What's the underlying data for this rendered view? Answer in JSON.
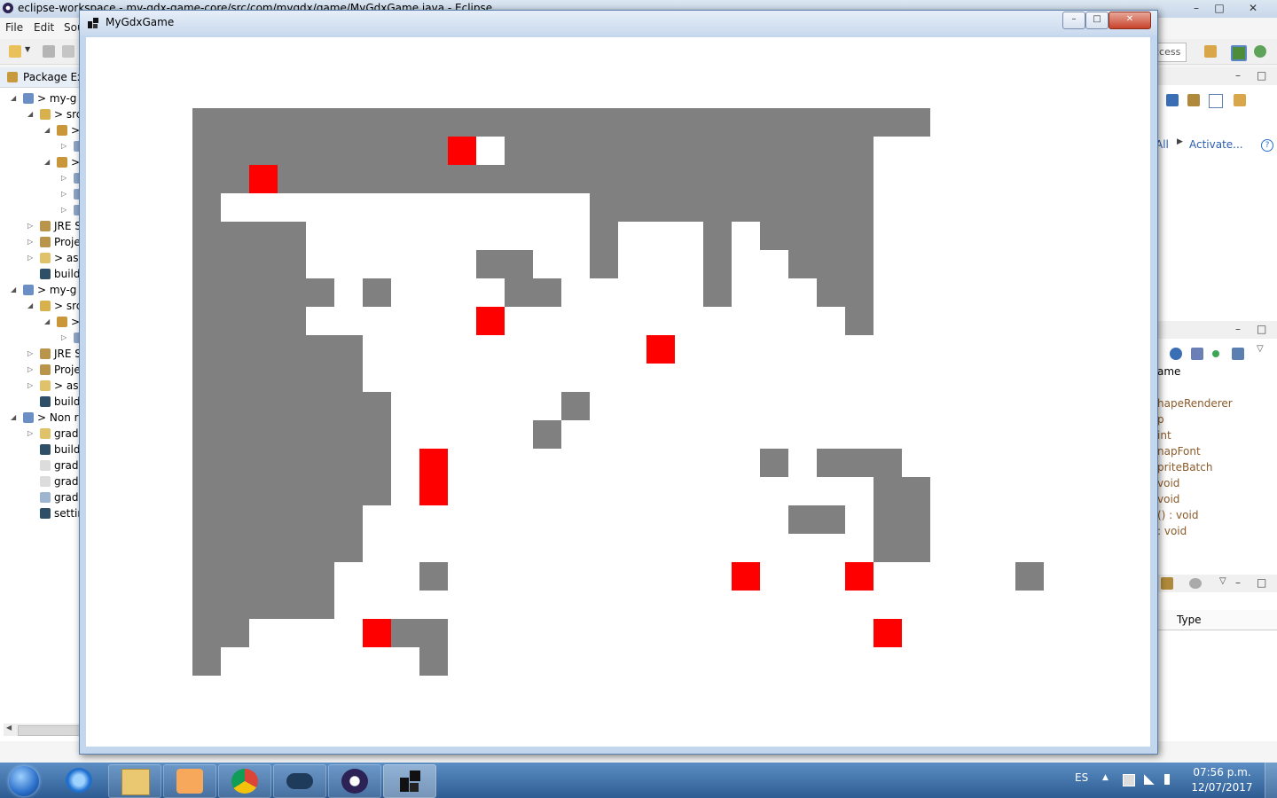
{
  "eclipse": {
    "title": "eclipse-workspace - my-gdx-game-core/src/com/mygdx/game/MyGdxGame.java - Eclipse",
    "menu": [
      "File",
      "Edit",
      "Sou"
    ],
    "quick_access": "ccess",
    "package_explorer": {
      "title": "Package Exp",
      "rows": [
        {
          "indent": 0,
          "arrow": "◢",
          "label": "> my-g",
          "icon": "project-icon"
        },
        {
          "indent": 1,
          "arrow": "◢",
          "label": "> src",
          "icon": "source-folder-icon"
        },
        {
          "indent": 2,
          "arrow": "◢",
          "label": ">",
          "icon": "package-icon"
        },
        {
          "indent": 3,
          "arrow": "▷",
          "label": "",
          "icon": "java-file-icon"
        },
        {
          "indent": 2,
          "arrow": "◢",
          "label": ">",
          "icon": "package-icon"
        },
        {
          "indent": 3,
          "arrow": "▷",
          "label": "",
          "icon": "java-file-icon"
        },
        {
          "indent": 3,
          "arrow": "▷",
          "label": "",
          "icon": "java-file-icon"
        },
        {
          "indent": 3,
          "arrow": "▷",
          "label": "",
          "icon": "java-file-icon"
        },
        {
          "indent": 1,
          "arrow": "▷",
          "label": "JRE S",
          "icon": "library-icon"
        },
        {
          "indent": 1,
          "arrow": "▷",
          "label": "Proje",
          "icon": "library-icon"
        },
        {
          "indent": 1,
          "arrow": "▷",
          "label": "> as",
          "icon": "folder-icon"
        },
        {
          "indent": 1,
          "arrow": "",
          "label": "build",
          "icon": "gradle-icon"
        },
        {
          "indent": 0,
          "arrow": "◢",
          "label": "> my-g",
          "icon": "project-icon"
        },
        {
          "indent": 1,
          "arrow": "◢",
          "label": "> src",
          "icon": "source-folder-icon"
        },
        {
          "indent": 2,
          "arrow": "◢",
          "label": ">",
          "icon": "package-icon"
        },
        {
          "indent": 3,
          "arrow": "▷",
          "label": "",
          "icon": "java-file-icon"
        },
        {
          "indent": 1,
          "arrow": "▷",
          "label": "JRE S",
          "icon": "library-icon"
        },
        {
          "indent": 1,
          "arrow": "▷",
          "label": "Proje",
          "icon": "library-icon"
        },
        {
          "indent": 1,
          "arrow": "▷",
          "label": "> as",
          "icon": "folder-icon"
        },
        {
          "indent": 1,
          "arrow": "",
          "label": "build",
          "icon": "gradle-icon"
        },
        {
          "indent": 0,
          "arrow": "◢",
          "label": "> Non r",
          "icon": "project-icon"
        },
        {
          "indent": 1,
          "arrow": "▷",
          "label": "gradl",
          "icon": "folder-icon"
        },
        {
          "indent": 1,
          "arrow": "",
          "label": "build",
          "icon": "gradle-icon"
        },
        {
          "indent": 1,
          "arrow": "",
          "label": "gradl",
          "icon": "file-icon"
        },
        {
          "indent": 1,
          "arrow": "",
          "label": "gradl",
          "icon": "file-icon"
        },
        {
          "indent": 1,
          "arrow": "",
          "label": "gradl",
          "icon": "settings-file-icon"
        },
        {
          "indent": 1,
          "arrow": "",
          "label": "settin",
          "icon": "gradle-icon"
        }
      ]
    },
    "right_panel": {
      "link_all": "All",
      "activate": "Activate...",
      "outline_header": "ame",
      "outline_items": [
        "hapeRenderer",
        "p",
        "int",
        "napFont",
        "priteBatch",
        "void",
        "void",
        "() : void",
        ": void"
      ],
      "table_header": "Type"
    }
  },
  "game_window": {
    "title": "MyGdxGame",
    "min_label": "–",
    "max_label": "□",
    "close_label": "✕",
    "grid": {
      "cols": 30,
      "rows": 20,
      "wall_color": "#808080",
      "item_color": "#ff0000",
      "wall_cells": [
        [
          4,
          1,
          30
        ],
        [
          4,
          2,
          12
        ],
        [
          12,
          2,
          13
        ],
        [
          15,
          2,
          17
        ],
        [
          17,
          2,
          28
        ],
        [
          4,
          3,
          12
        ],
        [
          12,
          3,
          17
        ],
        [
          17,
          3,
          28
        ],
        [
          4,
          4,
          5
        ],
        [
          18,
          4,
          20
        ],
        [
          20,
          4,
          28
        ],
        [
          4,
          5,
          8
        ],
        [
          18,
          5,
          19
        ],
        [
          22,
          5,
          23
        ],
        [
          24,
          5,
          25
        ],
        [
          25,
          5,
          28
        ],
        [
          4,
          6,
          8
        ],
        [
          14,
          6,
          16
        ],
        [
          18,
          6,
          19
        ],
        [
          22,
          6,
          23
        ],
        [
          25,
          6,
          28
        ],
        [
          4,
          7,
          9
        ],
        [
          10,
          7,
          11
        ],
        [
          15,
          7,
          17
        ],
        [
          22,
          7,
          23
        ],
        [
          26,
          7,
          28
        ],
        [
          4,
          8,
          8
        ],
        [
          27,
          8,
          28
        ],
        [
          4,
          9,
          10
        ],
        [
          28,
          9,
          28
        ],
        [
          4,
          10,
          10
        ],
        [
          28,
          10,
          28
        ],
        [
          4,
          11,
          11
        ],
        [
          17,
          11,
          18
        ],
        [
          4,
          12,
          11
        ],
        [
          16,
          12,
          17
        ],
        [
          4,
          13,
          11
        ],
        [
          24,
          13,
          25
        ],
        [
          26,
          13,
          29
        ],
        [
          4,
          14,
          11
        ],
        [
          28,
          14,
          30
        ],
        [
          4,
          15,
          10
        ],
        [
          25,
          15,
          27
        ],
        [
          28,
          15,
          30
        ],
        [
          4,
          16,
          10
        ],
        [
          28,
          16,
          30
        ],
        [
          4,
          17,
          9
        ],
        [
          12,
          17,
          13
        ],
        [
          33,
          17,
          34
        ],
        [
          4,
          18,
          9
        ],
        [
          4,
          19,
          6
        ],
        [
          11,
          19,
          13
        ],
        [
          4,
          20,
          5
        ],
        [
          12,
          20,
          13
        ]
      ],
      "item_cells": [
        [
          13,
          2
        ],
        [
          6,
          3
        ],
        [
          14,
          8
        ],
        [
          20,
          9
        ],
        [
          12,
          13
        ],
        [
          12,
          14
        ],
        [
          23,
          17
        ],
        [
          27,
          17
        ],
        [
          10,
          19
        ],
        [
          28,
          19
        ]
      ]
    }
  },
  "taskbar": {
    "apps": [
      "explorer-icon",
      "media-player-icon",
      "chrome-icon",
      "gamepad-icon",
      "eclipse-icon",
      "libgdx-icon"
    ],
    "language": "ES",
    "time": "07:56 p.m.",
    "date": "12/07/2017"
  }
}
